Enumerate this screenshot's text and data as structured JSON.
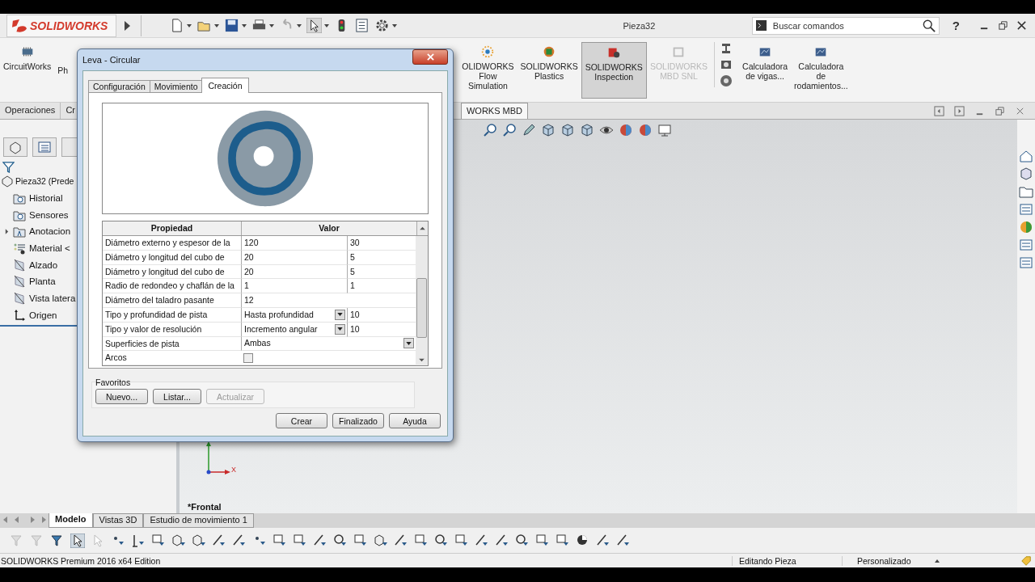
{
  "app": {
    "logo": "SOLIDWORKS",
    "document_title": "Pieza32",
    "search": {
      "placeholder": "Buscar comandos"
    },
    "help": "?"
  },
  "ribbon": {
    "items": [
      {
        "lines": [
          "CircuitWorks"
        ],
        "kind": "circuit",
        "selected": false,
        "disabled": false
      },
      {
        "lines": [
          "Ph"
        ],
        "kind": "none",
        "selected": false,
        "disabled": false
      },
      {
        "lines": [
          "OLIDWORKS",
          "Flow",
          "Simulation"
        ],
        "kind": "flow",
        "selected": false,
        "disabled": false
      },
      {
        "lines": [
          "SOLIDWORKS",
          "Plastics"
        ],
        "kind": "plastics",
        "selected": false,
        "disabled": false
      },
      {
        "lines": [
          "SOLIDWORKS",
          "Inspection"
        ],
        "kind": "inspection",
        "selected": true,
        "disabled": false
      },
      {
        "lines": [
          "SOLIDWORKS",
          "MBD SNL"
        ],
        "kind": "mbd",
        "selected": false,
        "disabled": true
      },
      {
        "lines": [
          "Calculadora",
          "de vigas..."
        ],
        "kind": "calc",
        "selected": false,
        "disabled": false
      },
      {
        "lines": [
          "Calculadora",
          "de",
          "rodamientos..."
        ],
        "kind": "calc",
        "selected": false,
        "disabled": false
      }
    ]
  },
  "command_tabs": [
    {
      "label": "Operaciones",
      "selected": false
    },
    {
      "label": "Cr",
      "selected": false
    },
    {
      "label": "WORKS MBD",
      "selected": true
    }
  ],
  "feature_tree": {
    "label": "Pieza32 (Prede",
    "children": [
      {
        "label": "Historial",
        "kind": "history",
        "expander": false
      },
      {
        "label": "Sensores",
        "kind": "sensor",
        "expander": false
      },
      {
        "label": "Anotacion",
        "kind": "annotation",
        "expander": true
      },
      {
        "label": "Material <",
        "kind": "material",
        "expander": false
      },
      {
        "label": "Alzado",
        "kind": "plane",
        "expander": false
      },
      {
        "label": "Planta",
        "kind": "plane",
        "expander": false
      },
      {
        "label": "Vista latera",
        "kind": "plane",
        "expander": false
      },
      {
        "label": "Origen",
        "kind": "origin",
        "expander": false
      }
    ]
  },
  "dialog": {
    "title": "Leva - Circular",
    "tabs": [
      {
        "label": "Configuración",
        "selected": false
      },
      {
        "label": "Movimiento",
        "selected": false
      },
      {
        "label": "Creación",
        "selected": true
      }
    ],
    "table": {
      "columns": [
        "Propiedad",
        "Valor"
      ],
      "rows": [
        {
          "kind": "pair",
          "property": "Diámetro externo y espesor de la",
          "value": "120",
          "value_2": "30"
        },
        {
          "kind": "pair",
          "property": "Diámetro y longitud del cubo de",
          "value": "20",
          "value_2": "5"
        },
        {
          "kind": "pair",
          "property": "Diámetro y longitud del cubo de",
          "value": "20",
          "value_2": "5"
        },
        {
          "kind": "pair",
          "property": "Radio de redondeo y chaflán de la",
          "value": "1",
          "value_2": "1"
        },
        {
          "kind": "single",
          "property": "Diámetro del taladro pasante",
          "value": "12"
        },
        {
          "kind": "combo",
          "property": "Tipo y profundidad de pista",
          "value": "Hasta profundidad",
          "value_2": "10"
        },
        {
          "kind": "combo",
          "property": "Tipo y valor de resolución",
          "value": "Incremento angular",
          "value_2": "10"
        },
        {
          "kind": "wide-combo",
          "property": "Superficies de pista",
          "value": "Ambas"
        },
        {
          "kind": "checkbox",
          "property": "Arcos",
          "checked": false
        }
      ]
    },
    "favorites": {
      "label": "Favoritos",
      "buttons": [
        {
          "label": "Nuevo...",
          "disabled": false
        },
        {
          "label": "Listar...",
          "disabled": false
        },
        {
          "label": "Actualizar",
          "disabled": true
        }
      ]
    },
    "buttons": [
      "Crear",
      "Finalizado",
      "Ayuda"
    ]
  },
  "viewport": {
    "view_label": "*Frontal",
    "axis_label": "X"
  },
  "bottom_tabs": [
    {
      "label": "Modelo",
      "selected": true
    },
    {
      "label": "Vistas 3D",
      "selected": false
    },
    {
      "label": "Estudio de movimiento 1",
      "selected": false
    }
  ],
  "status_bar": {
    "edition": "SOLIDWORKS Premium 2016 x64 Edition",
    "mode": "Editando Pieza",
    "units": "Personalizado"
  }
}
